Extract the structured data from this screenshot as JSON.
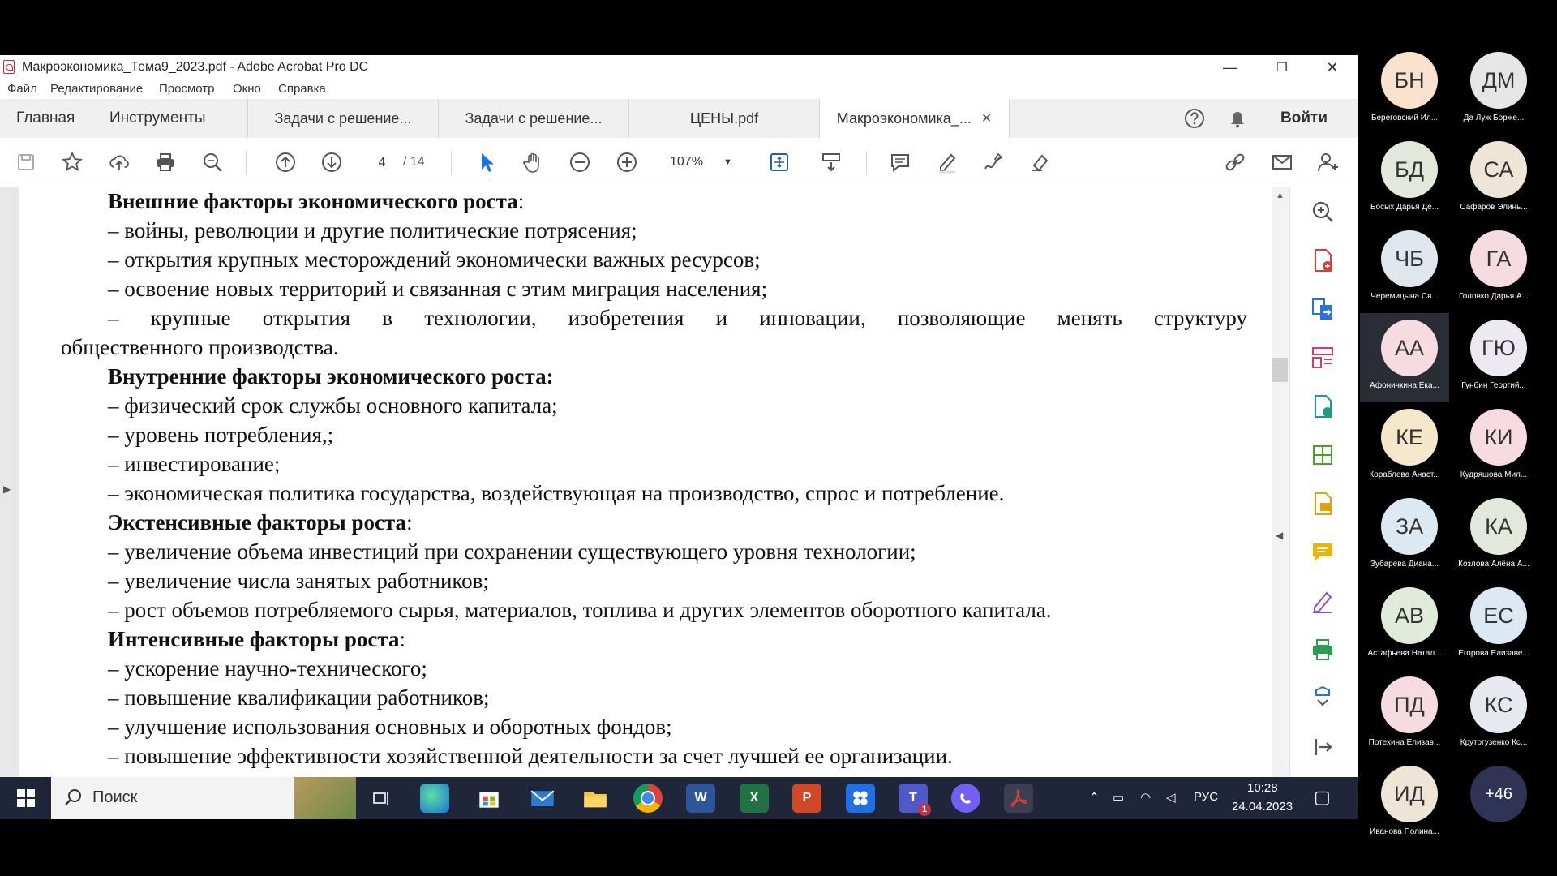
{
  "window": {
    "title": "Макроэкономика_Тема9_2023.pdf - Adobe Acrobat Pro DC",
    "controls": {
      "minimize": "—",
      "restore": "❐",
      "close": "✕"
    }
  },
  "menu": [
    "Файл",
    "Редактирование",
    "Просмотр",
    "Окно",
    "Справка"
  ],
  "tabs": {
    "home": "Главная",
    "tools": "Инструменты",
    "documents": [
      {
        "label": "Задачи с решение...",
        "active": false
      },
      {
        "label": "Задачи с решение...",
        "active": false
      },
      {
        "label": "ЦЕНЫ.pdf",
        "active": false
      },
      {
        "label": "Макроэкономика_...",
        "active": true
      }
    ],
    "signin": "Войти",
    "close_glyph": "✕"
  },
  "toolbar": {
    "page_current": "4",
    "page_total": "/ 14",
    "zoom": "107%"
  },
  "document": {
    "lines": [
      {
        "bold": "Внешние факторы экономического роста",
        "text": ":"
      },
      {
        "bold": "",
        "text": "– войны, революции и другие политические потрясения;"
      },
      {
        "bold": "",
        "text": "– открытия крупных месторождений экономически важных ресурсов;"
      },
      {
        "bold": "",
        "text": "– освоение новых территорий и связанная с этим миграция населения;"
      },
      {
        "bold": "",
        "text": "–  крупные  открытия  в  технологии,  изобретения  и  инновации,  позволяющие  менять  структуру"
      },
      {
        "bold": "",
        "text": "общественного производства."
      },
      {
        "bold": "Внутренние факторы экономического роста:",
        "text": ""
      },
      {
        "bold": "",
        "text": "– физический срок службы основного капитала;"
      },
      {
        "bold": "",
        "text": "– уровень потребления,;"
      },
      {
        "bold": "",
        "text": "– инвестирование;"
      },
      {
        "bold": "",
        "text": "– экономическая политика государства, воздействующая на производство, спрос и потребление."
      },
      {
        "bold": "Экстенсивные факторы роста",
        "text": ":"
      },
      {
        "bold": "",
        "text": "– увеличение объема инвестиций при сохранении существующего уровня технологии;"
      },
      {
        "bold": "",
        "text": "– увеличение числа занятых работников;"
      },
      {
        "bold": "",
        "text": "– рост объемов потребляемого сырья, материалов, топлива и других элементов оборотного капитала."
      },
      {
        "bold": "Интенсивные факторы роста",
        "text": ":"
      },
      {
        "bold": "",
        "text": "– ускорение научно-технического;"
      },
      {
        "bold": "",
        "text": "– повышение квалификации работников;"
      },
      {
        "bold": "",
        "text": "– улучшение использования основных и оборотных фондов;"
      },
      {
        "bold": "",
        "text": "– повышение эффективности хозяйственной деятельности за счет лучшей ее организации."
      }
    ]
  },
  "taskbar": {
    "search_label": "Поиск",
    "apps": [
      "task-view",
      "edge",
      "store",
      "mail",
      "file-explorer",
      "chrome",
      "word",
      "excel",
      "powerpoint",
      "zoom",
      "teams",
      "viber",
      "acrobat"
    ],
    "word_glyph": "W",
    "excel_glyph": "X",
    "powerpoint_glyph": "P",
    "teams_glyph": "T",
    "teams_badge": "1",
    "language": "РУС",
    "time": "10:28",
    "date": "24.04.2023"
  },
  "participants": [
    {
      "initials": "БН",
      "name": "Береговский Ил...",
      "color": "#f9e3cf",
      "selected": false
    },
    {
      "initials": "ДМ",
      "name": "Да Луж Борже...",
      "color": "#e6e6e6",
      "selected": false
    },
    {
      "initials": "БД",
      "name": "Босых Дарья Де...",
      "color": "#e3e8dc",
      "selected": false
    },
    {
      "initials": "СА",
      "name": "Сафаров Элинь...",
      "color": "#eee5d6",
      "selected": false
    },
    {
      "initials": "ЧБ",
      "name": "Черемицына Св...",
      "color": "#dfe6ee",
      "selected": false
    },
    {
      "initials": "ГА",
      "name": "Головко Дарья А...",
      "color": "#f6dbe1",
      "selected": false
    },
    {
      "initials": "АА",
      "name": "Афоничкина Ека...",
      "color": "#f6dbe1",
      "selected": true
    },
    {
      "initials": "ГЮ",
      "name": "Гунбин Георгий...",
      "color": "#ece9f2",
      "selected": false
    },
    {
      "initials": "КЕ",
      "name": "Кораблева Анаст...",
      "color": "#f5e7c9",
      "selected": false
    },
    {
      "initials": "КИ",
      "name": "Кудряшова Мил...",
      "color": "#f6dbe1",
      "selected": false
    },
    {
      "initials": "ЗА",
      "name": "Зубарева Диана...",
      "color": "#dce8f2",
      "selected": false
    },
    {
      "initials": "КА",
      "name": "Козлова Алёна А...",
      "color": "#e3e8dc",
      "selected": false
    },
    {
      "initials": "АВ",
      "name": "Астафьева Натал...",
      "color": "#e1ebdb",
      "selected": false
    },
    {
      "initials": "ЕС",
      "name": "Егорова Елизаве...",
      "color": "#dce8f2",
      "selected": false
    },
    {
      "initials": "ПД",
      "name": "Потехина Елизав...",
      "color": "#f6dbe1",
      "selected": false
    },
    {
      "initials": "КС",
      "name": "Крутогузенко Кс...",
      "color": "#e6eaf0",
      "selected": false
    },
    {
      "initials": "ИД",
      "name": "Иванова Полина...",
      "color": "#eee5d6",
      "selected": false
    },
    {
      "initials": "+46",
      "name": "",
      "color": "#2f3454",
      "selected": false
    }
  ]
}
